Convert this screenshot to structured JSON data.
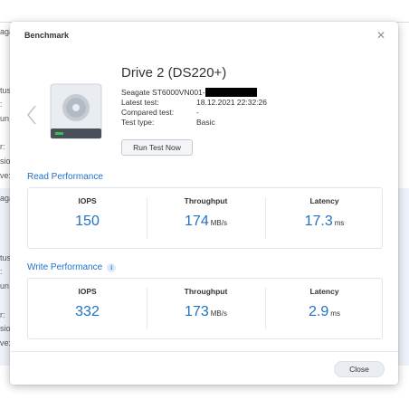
{
  "background": {
    "labels": [
      "aga",
      "tus",
      ":",
      "un",
      "r:",
      "sio",
      "ve:",
      "aga",
      "tus",
      ":",
      "un",
      "r:",
      "sio",
      "ve:"
    ]
  },
  "dialog": {
    "title": "Benchmark",
    "close_icon": "close-icon"
  },
  "drive": {
    "name": "Drive 2 (DS220+)",
    "model_prefix": "Seagate ST6000VN001-",
    "latest_test_label": "Latest test:",
    "latest_test_value": "18.12.2021 22:32:26",
    "compared_test_label": "Compared test:",
    "compared_test_value": "-",
    "test_type_label": "Test type:",
    "test_type_value": "Basic",
    "run_button": "Run Test Now"
  },
  "read": {
    "title": "Read Performance",
    "iops_label": "IOPS",
    "iops_value": "150",
    "throughput_label": "Throughput",
    "throughput_value": "174",
    "throughput_unit": "MB/s",
    "latency_label": "Latency",
    "latency_value": "17.3",
    "latency_unit": "ms"
  },
  "write": {
    "title": "Write Performance",
    "info_icon_label": "i",
    "iops_label": "IOPS",
    "iops_value": "332",
    "throughput_label": "Throughput",
    "throughput_value": "173",
    "throughput_unit": "MB/s",
    "latency_label": "Latency",
    "latency_value": "2.9",
    "latency_unit": "ms"
  },
  "footer": {
    "close_button": "Close"
  },
  "colors": {
    "accent": "#1f71c8",
    "drive_led": "#37c24a"
  }
}
